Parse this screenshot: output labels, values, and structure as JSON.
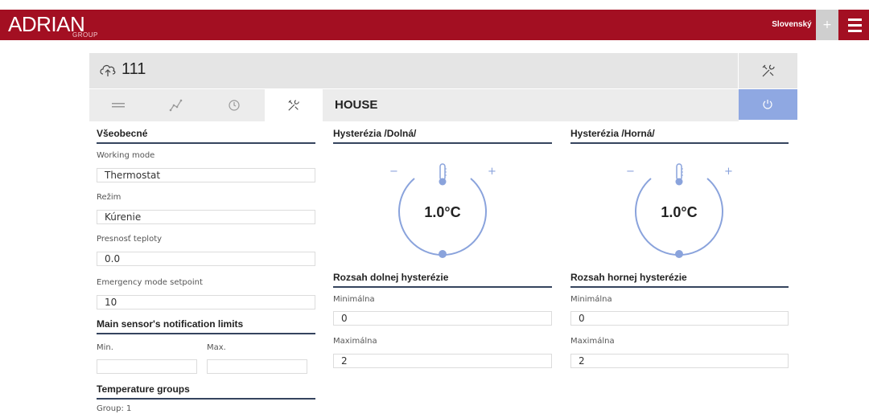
{
  "topbar": {
    "logo_text": "ADRIAN",
    "logo_sub": "GROUP",
    "language": "Slovenský",
    "plus_label": "+"
  },
  "device": {
    "name": "111",
    "section_title": "HOUSE"
  },
  "colors": {
    "brand_red": "#a30f22",
    "power_blue": "#8fa8e2",
    "dial_blue": "#8aa3dc",
    "section_line": "#35445e"
  },
  "tabs": [
    {
      "icon": "list-icon"
    },
    {
      "icon": "graph-icon"
    },
    {
      "icon": "clock-icon"
    },
    {
      "icon": "tools-icon",
      "active": true
    }
  ],
  "general": {
    "title": "Všeobecné",
    "working_mode_label": "Working mode",
    "working_mode_value": "Thermostat",
    "regime_label": "Režim",
    "regime_value": "Kúrenie",
    "precision_label": "Presnosť teploty",
    "precision_value": "0.0",
    "emergency_label": "Emergency mode setpoint",
    "emergency_value": "10"
  },
  "notification_limits": {
    "title": "Main sensor's notification limits",
    "min_label": "Min.",
    "max_label": "Max.",
    "min_value": "",
    "max_value": ""
  },
  "temperature_groups": {
    "title": "Temperature groups",
    "group_label": "Group: 1"
  },
  "hysteresis_low": {
    "title": "Hysterézia /Dolná/",
    "value": "1.0°C",
    "minus": "−",
    "plus": "+",
    "range_title": "Rozsah dolnej hysterézie",
    "min_label": "Minimálna",
    "min_value": "0",
    "max_label": "Maximálna",
    "max_value": "2"
  },
  "hysteresis_high": {
    "title": "Hysterézia /Horná/",
    "value": "1.0°C",
    "minus": "−",
    "plus": "+",
    "range_title": "Rozsah hornej hysterézie",
    "min_label": "Minimálna",
    "min_value": "0",
    "max_label": "Maximálna",
    "max_value": "2"
  }
}
